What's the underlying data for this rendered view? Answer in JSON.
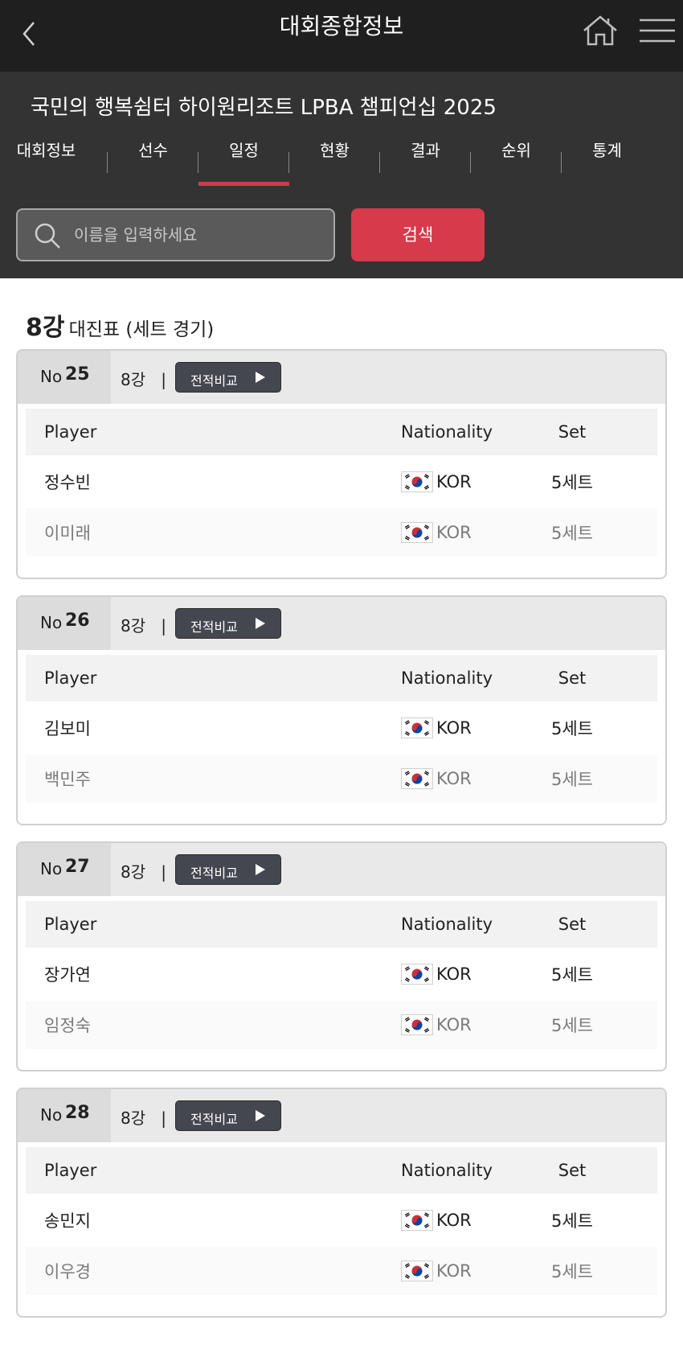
{
  "appbar": {
    "title": "대회종합정보",
    "back_icon": "chevron-left-icon",
    "home_icon": "home-icon",
    "menu_icon": "hamburger-menu-icon"
  },
  "event": {
    "title": "국민의 행복쉼터 하이원리조트 LPBA 챔피언십 2025"
  },
  "tabs": [
    {
      "label": "대회정보",
      "active": false
    },
    {
      "label": "선수",
      "active": false
    },
    {
      "label": "일정",
      "active": true
    },
    {
      "label": "현황",
      "active": false
    },
    {
      "label": "결과",
      "active": false
    },
    {
      "label": "순위",
      "active": false
    },
    {
      "label": "통계",
      "active": false
    }
  ],
  "search": {
    "placeholder": "이름을 입력하세요",
    "value": "",
    "button_label": "검색"
  },
  "section": {
    "round": "8강",
    "subtitle": "대진표 (세트 경기)"
  },
  "columns": {
    "player": "Player",
    "nationality": "Nationality",
    "set": "Set"
  },
  "matches": [
    {
      "no_label": "No",
      "no": "25",
      "round": "8강",
      "separator": "|",
      "compare_label": "전적비교",
      "players": [
        {
          "name": "정수빈",
          "nationality": "KOR",
          "set": "5세트"
        },
        {
          "name": "이미래",
          "nationality": "KOR",
          "set": "5세트"
        }
      ]
    },
    {
      "no_label": "No",
      "no": "26",
      "round": "8강",
      "separator": "|",
      "compare_label": "전적비교",
      "players": [
        {
          "name": "김보미",
          "nationality": "KOR",
          "set": "5세트"
        },
        {
          "name": "백민주",
          "nationality": "KOR",
          "set": "5세트"
        }
      ]
    },
    {
      "no_label": "No",
      "no": "27",
      "round": "8강",
      "separator": "|",
      "compare_label": "전적비교",
      "players": [
        {
          "name": "장가연",
          "nationality": "KOR",
          "set": "5세트"
        },
        {
          "name": "임정숙",
          "nationality": "KOR",
          "set": "5세트"
        }
      ]
    },
    {
      "no_label": "No",
      "no": "28",
      "round": "8강",
      "separator": "|",
      "compare_label": "전적비교",
      "players": [
        {
          "name": "송민지",
          "nationality": "KOR",
          "set": "5세트"
        },
        {
          "name": "이우경",
          "nationality": "KOR",
          "set": "5세트"
        }
      ]
    }
  ],
  "colors": {
    "accent": "#d63a4b",
    "appbar": "#1f1f1f",
    "header": "#333333",
    "compare_button": "#444750"
  }
}
